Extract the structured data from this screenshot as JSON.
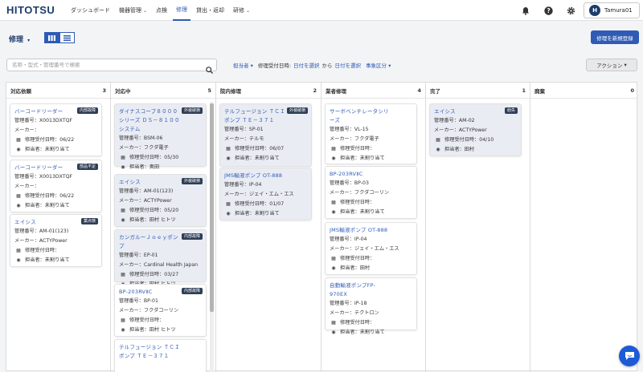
{
  "header": {
    "logo": "HITOTSU",
    "nav": [
      {
        "label": "ダッシュボード",
        "caret": ""
      },
      {
        "label": "機器管理",
        "caret": "⌄"
      },
      {
        "label": "点検",
        "caret": ""
      },
      {
        "label": "修理",
        "caret": ""
      },
      {
        "label": "貸出・返却",
        "caret": ""
      },
      {
        "label": "研修",
        "caret": "⌄"
      }
    ],
    "active_nav": "修理",
    "user": {
      "initial": "H",
      "name": "Tamura01"
    }
  },
  "page": {
    "title": "修理",
    "title_caret": "▾",
    "new_button": "修理を新規登録"
  },
  "filters": {
    "search_placeholder": "名称・型式・管理番号で検索",
    "assignee": "担当者",
    "received_label": "修理受付日時:",
    "date_from": "日付を選択",
    "from_word": "から",
    "date_to": "日付を選択",
    "category": "事象区分",
    "caret": "▾",
    "action": "アクション",
    "action_caret": "▾"
  },
  "columns": [
    {
      "name": "対応依頼",
      "count": "3",
      "cards": [
        {
          "title": "バーコードリーダー",
          "badge": "内部故障",
          "mgmt": "管理番号：X0013DXTQF",
          "maker": "メーカー：",
          "date": "修理受付日時：06/22",
          "assignee": "担当者：未割り当て"
        },
        {
          "title": "バーコードリーダー",
          "badge": "部品不足",
          "mgmt": "管理番号：X0013DXTQF",
          "maker": "メーカー：",
          "date": "修理受付日時：06/22",
          "assignee": "担当者：未割り当て"
        },
        {
          "title": "エイシス",
          "badge": "業点検",
          "mgmt": "管理番号：AM-01(123)",
          "maker": "メーカー：ACTYPower",
          "date": "修理受付日時：",
          "assignee": "担当者：未割り当て"
        }
      ]
    },
    {
      "name": "対応中",
      "count": "5",
      "cards": [
        {
          "title": "ダイナスコープ８０００シリーズ ＤＳ－８１００システム",
          "badge": "外装破損",
          "mgmt": "管理番号：BSM-06",
          "maker": "メーカー：フクダ電子",
          "date": "修理受付日時：05/30",
          "assignee": "担当者：奥田"
        },
        {
          "title": "エイシス",
          "badge": "外装破損",
          "mgmt": "管理番号：AM-01(123)",
          "maker": "メーカー：ACTYPower",
          "date": "修理受付日時：05/20",
          "assignee": "担当者：田村 ヒトツ"
        },
        {
          "title": "カンガルーＪｏｅｙポンプ",
          "badge": "内部故障",
          "mgmt": "管理番号：EP-01",
          "maker": "メーカー：Cardinal Health Japan",
          "date": "修理受付日時：03/27",
          "assignee": "担当者：田村 ヒトツ"
        },
        {
          "title": "BP-203RVⅡC",
          "badge": "内部故障",
          "mgmt": "管理番号：BP-01",
          "maker": "メーカー：フクダコーリン",
          "date": "修理受付日時：",
          "assignee": "担当者：田村 ヒトツ"
        },
        {
          "title": "テルフュージョン ＴＣＩ ポンプ ＴＥ－３７１",
          "badge": "",
          "mgmt": "",
          "maker": "",
          "date": "",
          "assignee": ""
        }
      ]
    },
    {
      "name": "院内修理",
      "count": "2",
      "cards": [
        {
          "title": "テルフュージョン ＴＣＩ ポンプ ＴＥ－３７１",
          "badge": "外装破損",
          "mgmt": "管理番号：SP-01",
          "maker": "メーカー：テルモ",
          "date": "修理受付日時：06/07",
          "assignee": "担当者：未割り当て"
        },
        {
          "title": "JMS輸液ポンプ OT-888",
          "badge": "",
          "mgmt": "管理番号：IP-04",
          "maker": "メーカー：ジェイ・エム・エス",
          "date": "修理受付日時：01/07",
          "assignee": "担当者：未割り当て"
        }
      ]
    },
    {
      "name": "業者修理",
      "count": "4",
      "cards": [
        {
          "title": "サーボベンチレータシリーズ",
          "badge": "",
          "mgmt": "管理番号：VL-15",
          "maker": "メーカー：フクダ電子",
          "date": "修理受付日時：",
          "assignee": "担当者：未割り当て"
        },
        {
          "title": "BP-203RVⅡC",
          "badge": "",
          "mgmt": "管理番号：BP-03",
          "maker": "メーカー：フクダコーリン",
          "date": "修理受付日時：",
          "assignee": "担当者：未割り当て"
        },
        {
          "title": "JMS輸液ポンプ OT-888",
          "badge": "",
          "mgmt": "管理番号：IP-04",
          "maker": "メーカー：ジェイ・エム・エス",
          "date": "修理受付日時：",
          "assignee": "担当者：田村"
        },
        {
          "title": "自動輸液ポンプFP-970EX",
          "badge": "",
          "mgmt": "管理番号：IP-18",
          "maker": "メーカー：テクトロン",
          "date": "修理受付日時：",
          "assignee": "担当者：未割り当て"
        }
      ]
    },
    {
      "name": "完了",
      "count": "1",
      "cards": [
        {
          "title": "エイシス",
          "badge": "紛失",
          "mgmt": "管理番号：AM-02",
          "maker": "メーカー：ACTYPower",
          "date": "修理受付日時：04/10",
          "assignee": "担当者：田村"
        }
      ]
    },
    {
      "name": "廃棄",
      "count": "0",
      "cards": []
    }
  ]
}
